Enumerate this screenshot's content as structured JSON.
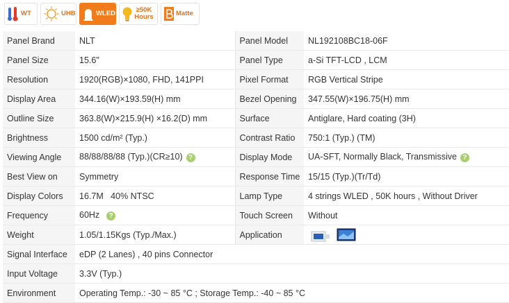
{
  "badges": [
    {
      "label": "WT",
      "icon": "thermometer-icon"
    },
    {
      "label": "UHB",
      "icon": "sun-icon"
    },
    {
      "label": "WLED",
      "icon": "led-icon"
    },
    {
      "label": "≥50K Hours",
      "icon": "bulb-icon"
    },
    {
      "label": "Matte",
      "icon": "matte-icon"
    }
  ],
  "specs": {
    "panel_brand": {
      "label": "Panel Brand",
      "value": "NLT"
    },
    "panel_model": {
      "label": "Panel Model",
      "value": "NL192108BC18-06F"
    },
    "panel_size": {
      "label": "Panel Size",
      "value": "15.6\""
    },
    "panel_type": {
      "label": "Panel Type",
      "value": "a-Si TFT-LCD , LCM"
    },
    "resolution": {
      "label": "Resolution",
      "value": "1920(RGB)×1080, FHD, 141PPI"
    },
    "pixel_format": {
      "label": "Pixel Format",
      "value": "RGB Vertical Stripe"
    },
    "display_area": {
      "label": "Display Area",
      "value": "344.16(W)×193.59(H) mm"
    },
    "bezel_opening": {
      "label": "Bezel Opening",
      "value": "347.55(W)×196.75(H) mm"
    },
    "outline_size": {
      "label": "Outline Size",
      "value": "363.8(W)×215.9(H) ×16.2(D) mm"
    },
    "surface": {
      "label": "Surface",
      "value": "Antiglare, Hard coating (3H)"
    },
    "brightness": {
      "label": "Brightness",
      "value": "1500 cd/m² (Typ.)"
    },
    "contrast_ratio": {
      "label": "Contrast Ratio",
      "value": "750:1 (Typ.) (TM)"
    },
    "viewing_angle": {
      "label": "Viewing Angle",
      "value": "88/88/88/88 (Typ.)(CR≥10)"
    },
    "display_mode": {
      "label": "Display Mode",
      "value": "UA-SFT, Normally Black, Transmissive"
    },
    "best_view": {
      "label": "Best View on",
      "value": "Symmetry"
    },
    "response_time": {
      "label": "Response Time",
      "value": "15/15 (Typ.)(Tr/Td)"
    },
    "display_colors": {
      "label": "Display Colors",
      "value": "16.7M   40% NTSC"
    },
    "lamp_type": {
      "label": "Lamp Type",
      "value": "4 strings WLED , 50K hours , Without Driver"
    },
    "frequency": {
      "label": "Frequency",
      "value": "60Hz"
    },
    "touch_screen": {
      "label": "Touch Screen",
      "value": "Without"
    },
    "weight": {
      "label": "Weight",
      "value": "1.05/1.15Kgs (Typ./Max.)"
    },
    "application": {
      "label": "Application",
      "value": ""
    },
    "signal_interface": {
      "label": "Signal Interface",
      "value": "eDP (2 Lanes) , 40 pins Connector"
    },
    "input_voltage": {
      "label": "Input Voltage",
      "value": "3.3V (Typ.)"
    },
    "environment": {
      "label": "Environment",
      "value": "Operating Temp.: -30 ~ 85 °C ; Storage Temp.: -40 ~ 85 °C"
    }
  },
  "help_glyph": "?",
  "colors": {
    "accent": "#f07c1c",
    "help": "#a8cf6f",
    "label_bg": "#f5f5f5"
  }
}
